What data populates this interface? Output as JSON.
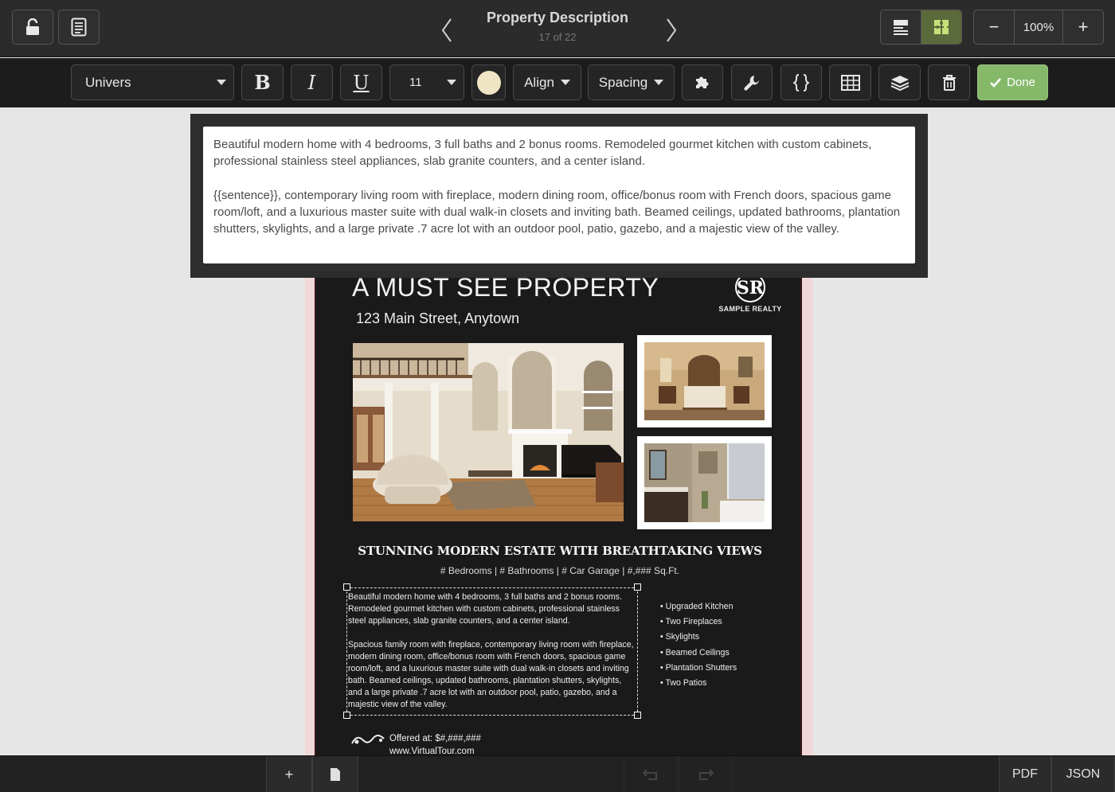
{
  "header": {
    "title": "Property Description",
    "page_indicator": "17 of 22",
    "zoom_level": "100%",
    "zoom_out": "−",
    "zoom_in": "+"
  },
  "toolbar": {
    "font_family": "Univers",
    "bold": "B",
    "italic": "I",
    "underline": "U",
    "font_size": "11",
    "text_color": "#efe5c4",
    "align": "Align",
    "spacing": "Spacing",
    "done": "Done",
    "accent_color": "#86b86a"
  },
  "editor": {
    "paragraphs": [
      "Beautiful modern home with 4 bedrooms, 3 full baths and 2 bonus rooms. Remodeled gourmet kitchen with custom cabinets, professional stainless steel appliances, slab granite counters, and a center island.",
      "{{sentence}}, contemporary living room with fireplace, modern dining room, office/bonus room with French doors, spacious game room/loft, and a luxurious master suite with dual walk-in closets and inviting bath. Beamed ceilings, updated bathrooms, plantation shutters, skylights, and a large private .7 acre lot with an outdoor pool, patio, gazebo, and a majestic view of the valley."
    ]
  },
  "flyer": {
    "headline": "A MUST SEE PROPERTY",
    "address": "123 Main Street, Anytown",
    "logo_initials": "SR",
    "logo_name": "SAMPLE REALTY",
    "estate_title": "STUNNING MODERN ESTATE WITH BREATHTAKING VIEWS",
    "specs": "# Bedrooms | # Bathrooms | # Car Garage | #,### Sq.Ft.",
    "description": [
      "Beautiful modern home with 4 bedrooms, 3 full baths and 2 bonus rooms. Remodeled gourmet kitchen with custom cabinets, professional stainless steel appliances, slab granite counters, and a center island.",
      "Spacious family room with fireplace, contemporary living room with fireplace, modern dining room, office/bonus room with French doors, spacious game room/loft, and a luxurious master suite with dual walk-in closets and inviting bath. Beamed ceilings, updated bathrooms, plantation shutters, skylights, and a large private .7 acre lot with an outdoor pool, patio, gazebo, and a majestic view of the valley."
    ],
    "features": [
      "Upgraded Kitchen",
      "Two Fireplaces",
      "Skylights",
      "Beamed Ceilings",
      "Plantation Shutters",
      "Two Patios"
    ],
    "offered": "Offered at: $#,###,###",
    "tour": "www.VirtualTour.com"
  },
  "bottom": {
    "add": "+",
    "pdf": "PDF",
    "json": "JSON"
  },
  "icons": [
    "unlock-icon",
    "document-list-icon",
    "chevron-left-icon",
    "chevron-right-icon",
    "layout-icon",
    "puzzle-grid-icon",
    "puzzle-icon",
    "wrench-icon",
    "braces-icon",
    "table-icon",
    "layers-icon",
    "trash-icon",
    "check-icon",
    "page-icon",
    "undo-icon",
    "redo-icon"
  ]
}
